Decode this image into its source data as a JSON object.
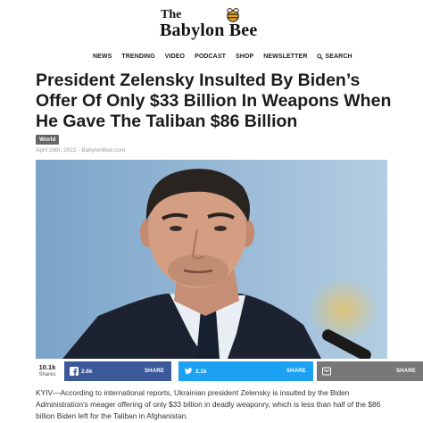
{
  "site": {
    "logo_the": "The",
    "logo_name": "Babylon Bee",
    "colors": {
      "logo_bee": "#e8a21d",
      "badge": "#666666",
      "facebook": "#3b5998",
      "twitter": "#1da1f2",
      "share_generic": "#777777"
    }
  },
  "nav": {
    "items": [
      "NEWS",
      "TRENDING",
      "VIDEO",
      "PODCAST",
      "SHOP",
      "NEWSLETTER"
    ],
    "search_label": "SEARCH",
    "search_icon": "search-icon"
  },
  "article": {
    "headline": "President Zelensky Insulted By Biden’s Offer Of Only $33 Billion In Weapons When He Gave The Taliban $86 Billion",
    "category": "World",
    "dateline": "April 28th, 2022 - BabylonBee.com",
    "body": "KYIV—According to international reports, Ukrainian president Zelensky is insulted by the Biden Administration's meager offering of only $33 billion in deadly weaponry, which is less than half of the $86 billion Biden left for the Taliban in Afghanistan."
  },
  "share": {
    "total": "10.1k",
    "total_label": "Shares",
    "facebook": {
      "count": "2.6k",
      "label": "SHARE",
      "icon": "facebook-icon"
    },
    "twitter": {
      "count": "2.1k",
      "label": "SHARE",
      "icon": "twitter-icon"
    },
    "generic": {
      "label": "SHARE",
      "icon": "share-icon"
    }
  }
}
